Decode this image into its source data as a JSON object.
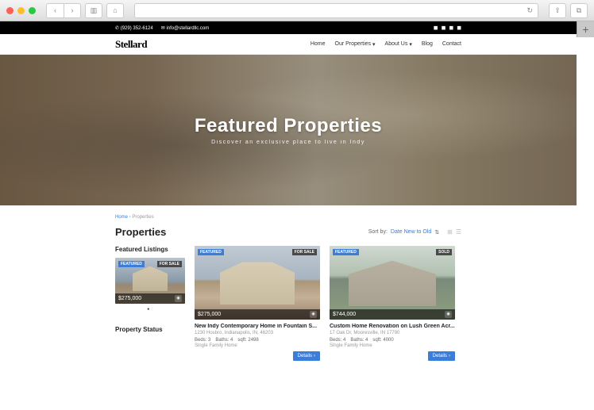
{
  "topbar": {
    "phone": "(929) 352-6124",
    "email": "info@stellardllc.com"
  },
  "nav": {
    "logo": "Stellard",
    "links": [
      "Home",
      "Our Properties",
      "About Us",
      "Blog",
      "Contact"
    ]
  },
  "hero": {
    "title": "Featured Properties",
    "subtitle": "Discover an exclusive place to live in Indy"
  },
  "breadcrumb": {
    "home": "Home",
    "current": "Properties"
  },
  "section_title": "Properties",
  "sort": {
    "label": "Sort by:",
    "value": "Date New to Old"
  },
  "sidebar": {
    "featured_title": "Featured Listings",
    "status_title": "Property Status",
    "thumb": {
      "featured": "FEATURED",
      "forsale": "FOR SALE",
      "price": "$275,000"
    }
  },
  "cards": [
    {
      "featured": "FEATURED",
      "tag": "FOR SALE",
      "price": "$275,000",
      "title": "New Indy Contemporary Home in Fountain S...",
      "addr": "1230 Hosbro, Indianapolis, IN, 46203",
      "beds": "Beds: 3",
      "baths": "Baths: 4",
      "sqft": "sqft: 2498",
      "type": "Single Family Home",
      "details": "Details"
    },
    {
      "featured": "FEATURED",
      "tag": "SOLD",
      "price": "$744,000",
      "title": "Custom Home Renovation on Lush Green Acr...",
      "addr": "17 Oak Dr, Mooresville, IN 17790",
      "beds": "Beds: 4",
      "baths": "Baths: 4",
      "sqft": "sqft: 4000",
      "type": "Single Family Home",
      "details": "Details"
    }
  ]
}
